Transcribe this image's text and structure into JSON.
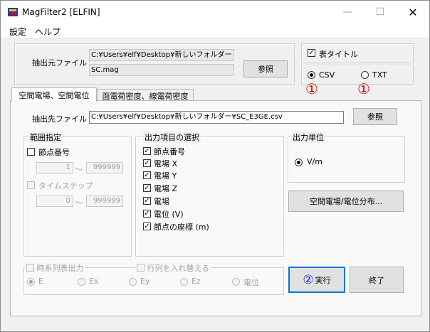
{
  "window": {
    "title": "MagFilter2 [ELFIN]",
    "controls": {
      "minimize": "—",
      "maximize": "☐",
      "close": "✕"
    }
  },
  "menu": {
    "items": [
      "設定",
      "ヘルプ"
    ]
  },
  "source": {
    "label": "抽出元ファイル",
    "path": "C:¥Users¥elf¥Desktop¥新しいフォルダー",
    "file": "SC.mag",
    "browse": "参照"
  },
  "options": {
    "table_title_label": "表タイトル",
    "table_title_checked": true,
    "csv_label": "CSV",
    "txt_label": "TXT",
    "selected_format": "CSV",
    "marker": "①"
  },
  "tabs": {
    "items": [
      "空間電場、空間電位",
      "面電荷密度、線電荷密度"
    ],
    "active": 0,
    "marker": "②"
  },
  "dest": {
    "label": "抽出先ファイル",
    "path": "C:¥Users¥elf¥Desktop¥新しいフォルダー¥SC_E3GE.csv",
    "browse": "参照"
  },
  "range": {
    "title": "範囲指定",
    "node_label": "節点番号",
    "node_from": "1",
    "node_to": "999999",
    "tilde": "～",
    "time_label": "タイムステップ",
    "time_from": "0",
    "time_to": "999999"
  },
  "output_items": {
    "title": "出力項目の選択",
    "items": [
      "節点番号",
      "電場 X",
      "電場 Y",
      "電場 Z",
      "電場",
      "電位 (V)",
      "節点の座標 (m)"
    ]
  },
  "output_unit": {
    "title": "出力単位",
    "unit": "V/m"
  },
  "dist_button": "空間電場/電位分布...",
  "timeseries": {
    "title": "時系列表出力",
    "swap_title": "行列を入れ替える",
    "radios": [
      "E",
      "Ex",
      "Ey",
      "Ez",
      "電位"
    ],
    "selected": "E"
  },
  "actions": {
    "run_marker": "②",
    "run": "実行",
    "exit": "終了"
  }
}
